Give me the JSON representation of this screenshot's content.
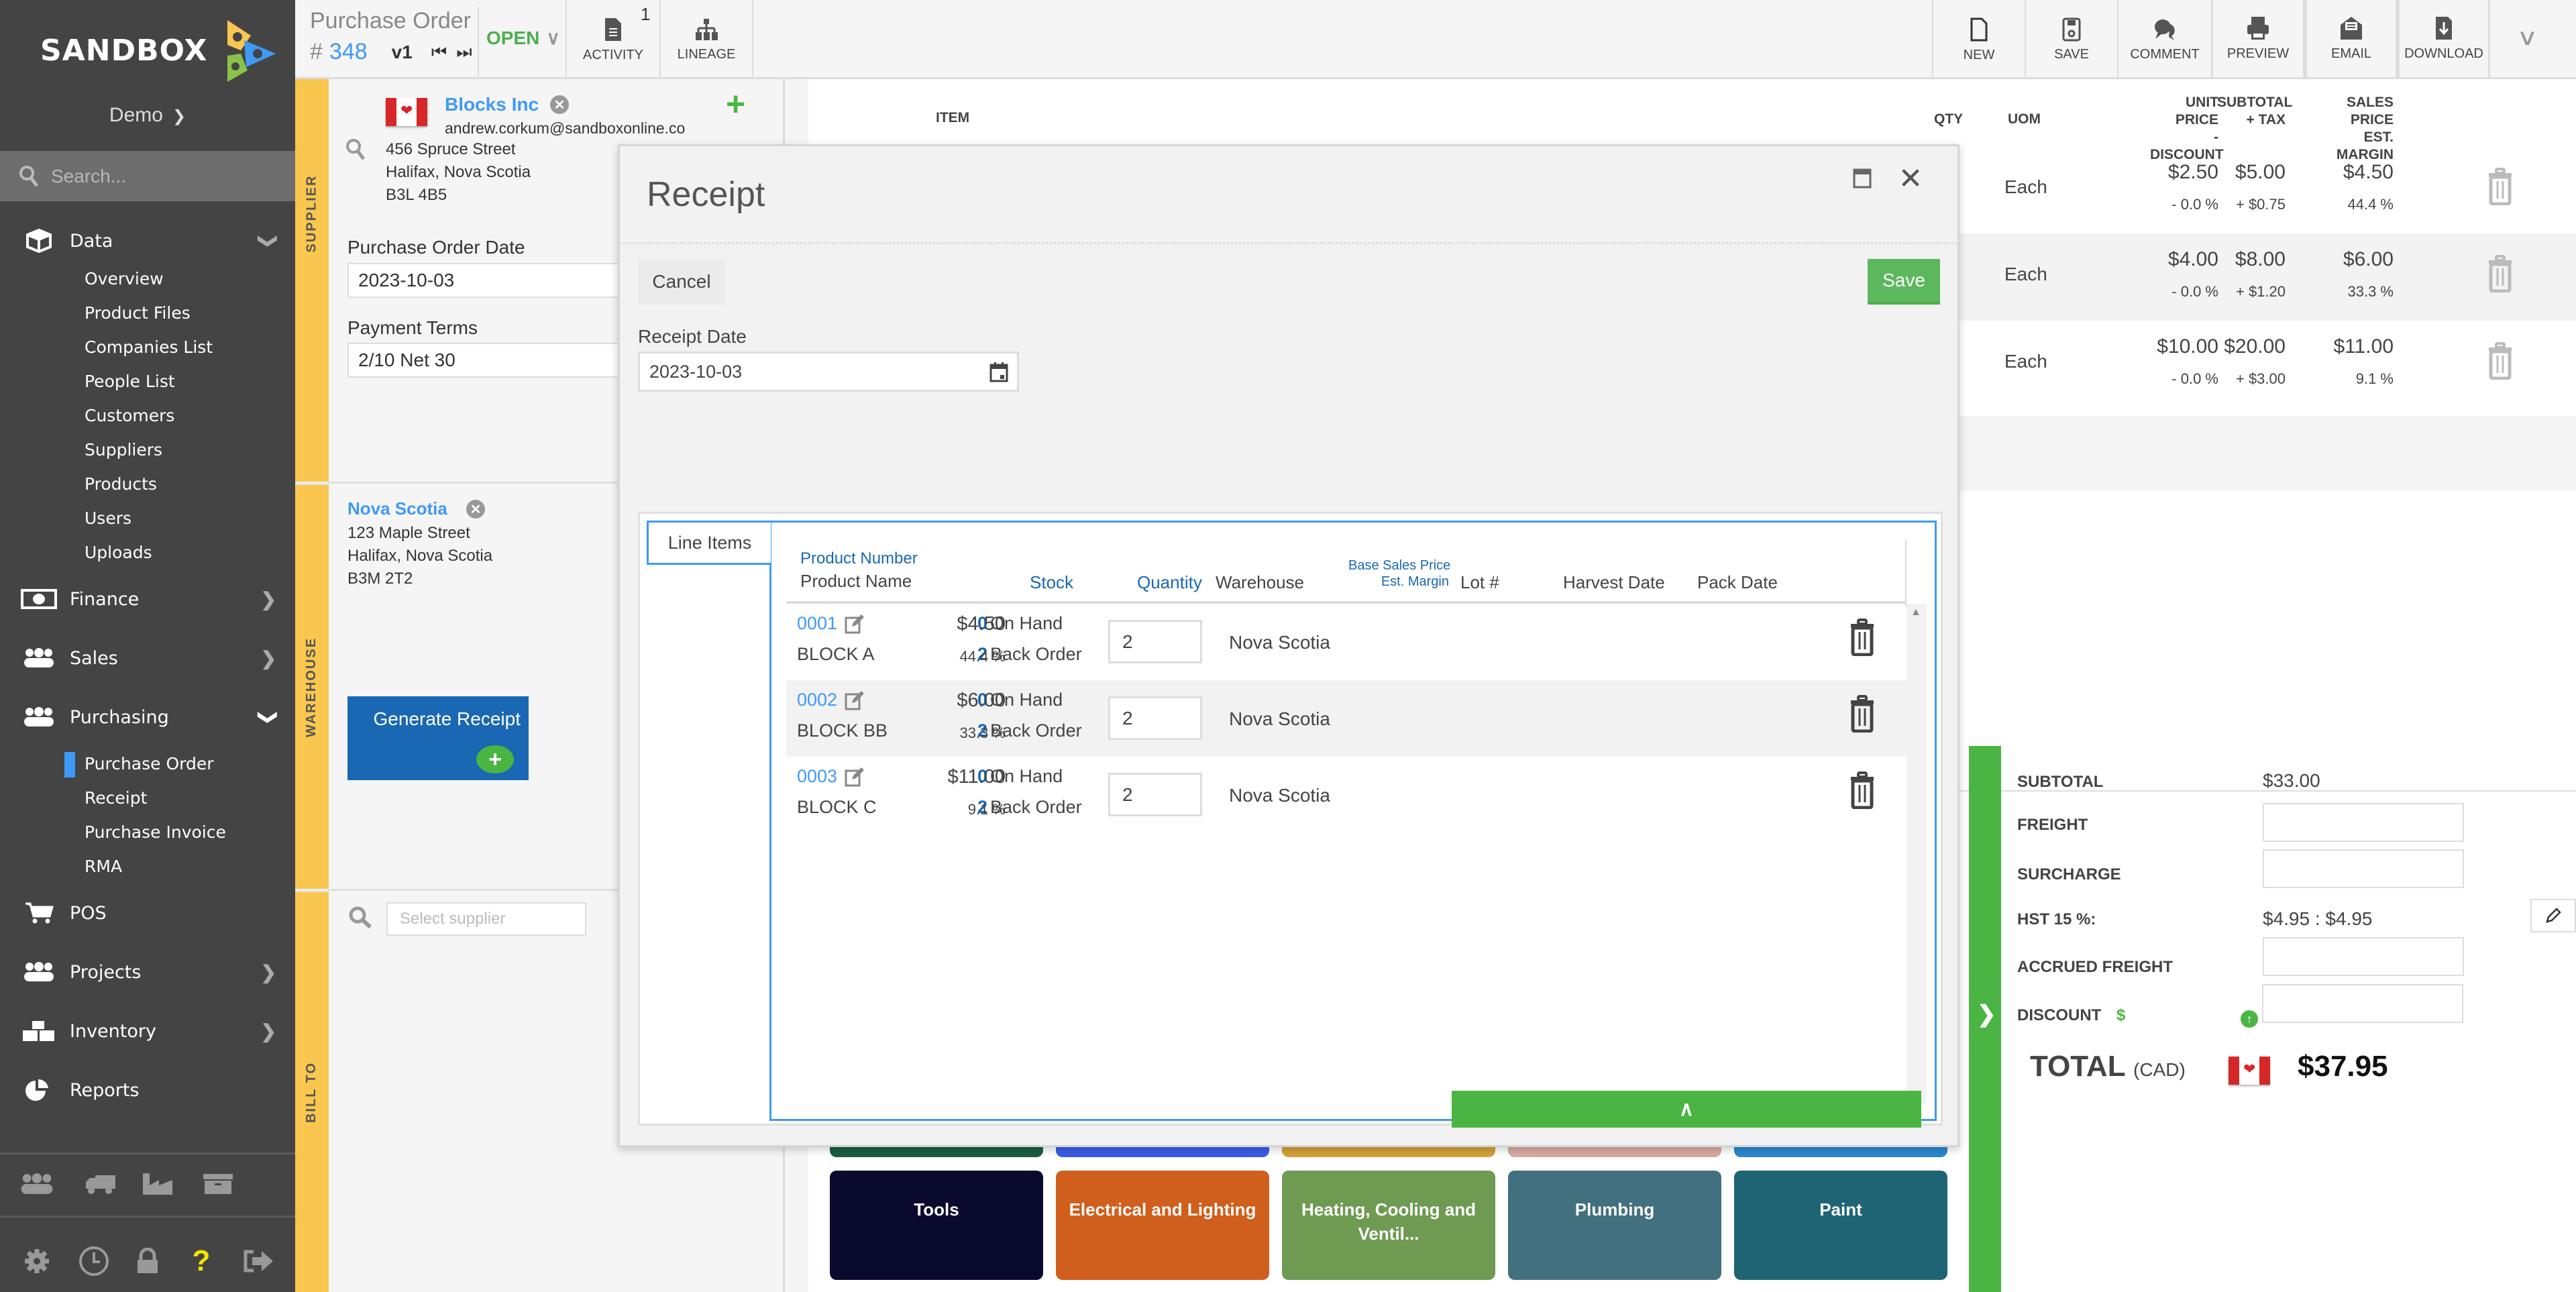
{
  "app": {
    "brand": "SANDBOX",
    "tenant": "Demo",
    "search_placeholder": "Search..."
  },
  "sidebar": {
    "sections": [
      {
        "label": "Data",
        "icon": "cube-icon",
        "expanded": true,
        "items": [
          "Overview",
          "Product Files",
          "Companies List",
          "People List",
          "Customers",
          "Suppliers",
          "Products",
          "Users",
          "Uploads"
        ]
      },
      {
        "label": "Finance",
        "icon": "money-icon",
        "expanded": false
      },
      {
        "label": "Sales",
        "icon": "users-icon",
        "expanded": false
      },
      {
        "label": "Purchasing",
        "icon": "users-icon",
        "expanded": true,
        "items": [
          "Purchase Order",
          "Receipt",
          "Purchase Invoice",
          "RMA"
        ],
        "active_item": "Purchase Order"
      },
      {
        "label": "POS",
        "icon": "cart-icon"
      },
      {
        "label": "Projects",
        "icon": "users-icon",
        "expanded": false
      },
      {
        "label": "Inventory",
        "icon": "boxes-icon",
        "expanded": false
      },
      {
        "label": "Reports",
        "icon": "pie-chart-icon"
      }
    ],
    "quick_icons": [
      "users-icon",
      "truck-icon",
      "factory-icon",
      "archive-icon"
    ],
    "footer_icons": [
      "gear-icon",
      "clock-icon",
      "lock-icon",
      "help-icon",
      "logout-icon"
    ]
  },
  "header": {
    "doc_type": "Purchase Order",
    "hash": "#",
    "number": "348",
    "version": "v1",
    "status": "OPEN",
    "activity_count": "1",
    "buttons": {
      "activity": "ACTIVITY",
      "lineage": "LINEAGE",
      "new": "NEW",
      "save": "SAVE",
      "comment": "COMMENT",
      "preview": "PREVIEW",
      "email": "EMAIL",
      "download": "DOWNLOAD"
    }
  },
  "side_tabs": {
    "supplier": "SUPPLIER",
    "warehouse": "WAREHOUSE",
    "bill_to": "BILL TO"
  },
  "supplier": {
    "name": "Blocks Inc",
    "email": "andrew.corkum@sandboxonline.co",
    "address": [
      "456 Spruce Street",
      "Halifax, Nova Scotia",
      "B3L 4B5"
    ],
    "po_date_label": "Purchase Order Date",
    "po_date": "2023-10-03",
    "terms_label": "Payment Terms",
    "terms": "2/10 Net 30"
  },
  "warehouse": {
    "name": "Nova Scotia",
    "address": [
      "123 Maple Street",
      "Halifax, Nova Scotia",
      "B3M 2T2"
    ],
    "generate_label": "Generate Receipt"
  },
  "bill_to": {
    "placeholder": "Select supplier"
  },
  "po_items": {
    "headers": {
      "item": "ITEM",
      "qty": "QTY",
      "uom": "UOM",
      "unit_price": "UNIT PRICE",
      "discount": "- DISCOUNT",
      "subtotal": "SUBTOTAL",
      "tax": "+ TAX",
      "sales_price": "SALES PRICE",
      "margin": "EST. MARGIN"
    },
    "rows": [
      {
        "uom": "Each",
        "unit_price": "$2.50",
        "discount": "- 0.0 %",
        "subtotal": "$5.00",
        "tax": "+ $0.75",
        "sales_price": "$4.50",
        "margin": "44.4 %"
      },
      {
        "uom": "Each",
        "unit_price": "$4.00",
        "discount": "- 0.0 %",
        "subtotal": "$8.00",
        "tax": "+ $1.20",
        "sales_price": "$6.00",
        "margin": "33.3 %"
      },
      {
        "uom": "Each",
        "unit_price": "$10.00",
        "discount": "- 0.0 %",
        "subtotal": "$20.00",
        "tax": "+ $3.00",
        "sales_price": "$11.00",
        "margin": "9.1 %"
      }
    ]
  },
  "totals": {
    "subtotal_label": "SUBTOTAL",
    "subtotal": "$33.00",
    "freight_label": "FREIGHT",
    "freight": "",
    "surcharge_label": "SURCHARGE",
    "surcharge": "",
    "tax_label": "HST 15 %:",
    "tax": "$4.95 : $4.95",
    "accrued_label": "ACCRUED FREIGHT",
    "accrued": "",
    "discount_label": "DISCOUNT",
    "discount_symbol": "$",
    "discount": "",
    "total_label": "TOTAL",
    "currency": "(CAD)",
    "total": "$37.95"
  },
  "categories": [
    {
      "label": "Tools",
      "color": "#0a0a2e"
    },
    {
      "label": "Electrical and Lighting",
      "color": "#d05e1c"
    },
    {
      "label": "Heating, Cooling and Ventil...",
      "color": "#6f9a52"
    },
    {
      "label": "Plumbing",
      "color": "#42707f"
    },
    {
      "label": "Paint",
      "color": "#1f6475"
    }
  ],
  "category_row_above_colors": [
    "#1b5e44",
    "#3a5de8",
    "#d4a13a",
    "#d9aaa0",
    "#2a88d0"
  ],
  "modal": {
    "title": "Receipt",
    "cancel": "Cancel",
    "save": "Save",
    "receipt_date_label": "Receipt Date",
    "receipt_date": "2023-10-03",
    "tab": "Line Items",
    "headers": {
      "product_number": "Product Number",
      "product_name": "Product Name",
      "stock": "Stock",
      "quantity": "Quantity",
      "warehouse": "Warehouse",
      "base_price": "Base Sales Price",
      "est_margin": "Est. Margin",
      "lot": "Lot #",
      "harvest": "Harvest Date",
      "pack": "Pack Date"
    },
    "rows": [
      {
        "number": "0001",
        "name": "BLOCK A",
        "on_hand": "0",
        "on_hand_label": "On Hand",
        "back_order": "2",
        "back_order_label": "Back Order",
        "qty": "2",
        "warehouse": "Nova Scotia",
        "price": "$4.50",
        "margin": "44.4 %"
      },
      {
        "number": "0002",
        "name": "BLOCK BB",
        "on_hand": "0",
        "on_hand_label": "On Hand",
        "back_order": "2",
        "back_order_label": "Back Order",
        "qty": "2",
        "warehouse": "Nova Scotia",
        "price": "$6.00",
        "margin": "33.3 %"
      },
      {
        "number": "0003",
        "name": "BLOCK C",
        "on_hand": "0",
        "on_hand_label": "On Hand",
        "back_order": "2",
        "back_order_label": "Back Order",
        "qty": "2",
        "warehouse": "Nova Scotia",
        "price": "$11.00",
        "margin": "9.1 %"
      }
    ]
  },
  "colors": {
    "brand_blue": "#3f9af6",
    "accent_green": "#4bb543",
    "side_tab_yellow": "#f9c74f",
    "sidebar_bg": "#444444",
    "primary_button": "#1a68b3"
  }
}
